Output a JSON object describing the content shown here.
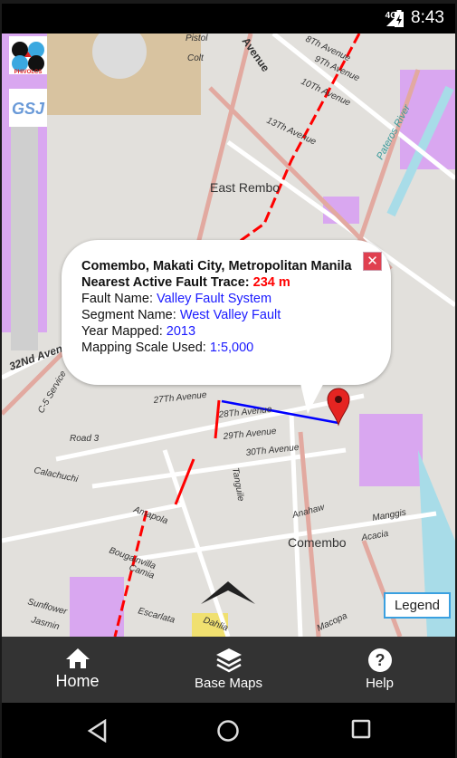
{
  "status_bar": {
    "network": "4G",
    "time": "8:43"
  },
  "logos": {
    "top": "DOST PHIVOLCS",
    "bottom": "GSJ"
  },
  "map": {
    "labels": [
      "East Rembo",
      "Comembo",
      "32Nd Avenue",
      "27Th Avenue",
      "28Th Avenue",
      "29Th Avenue",
      "30Th Avenue",
      "Pateros River",
      "Avenue",
      "8Th Avenue",
      "9Th Avenue",
      "10Th Avenue",
      "13Th Avenue",
      "Pistol",
      "Colt",
      "Road 3",
      "Calachuchi",
      "Amapola",
      "Bougainvilla",
      "Camia",
      "Sunflower",
      "Jasmin",
      "Escarlata",
      "Dahlia",
      "Anahaw",
      "Acacia",
      "Manggis",
      "Macopa",
      "Tanguile",
      "C-5 Service"
    ],
    "colors": {
      "fault_trace": "#ff0000",
      "nearest_line": "#0000ff",
      "marker": "#e52421"
    }
  },
  "popup": {
    "location": "Comembo, Makati City, Metropolitan Manila",
    "nearest_label": "Nearest Active Fault Trace: ",
    "nearest_value": "234 m",
    "fault_label": "Fault Name: ",
    "fault_value": "Valley Fault System",
    "segment_label": "Segment Name: ",
    "segment_value": "West Valley Fault",
    "year_label": "Year Mapped: ",
    "year_value": "2013",
    "scale_label": "Mapping Scale Used: ",
    "scale_value": "1:5,000",
    "close_icon": "close-icon"
  },
  "legend_button": "Legend",
  "bottom_nav": [
    {
      "label": "Home",
      "icon": "home-icon"
    },
    {
      "label": "Base Maps",
      "icon": "layers-icon"
    },
    {
      "label": "Help",
      "icon": "help-icon"
    }
  ]
}
